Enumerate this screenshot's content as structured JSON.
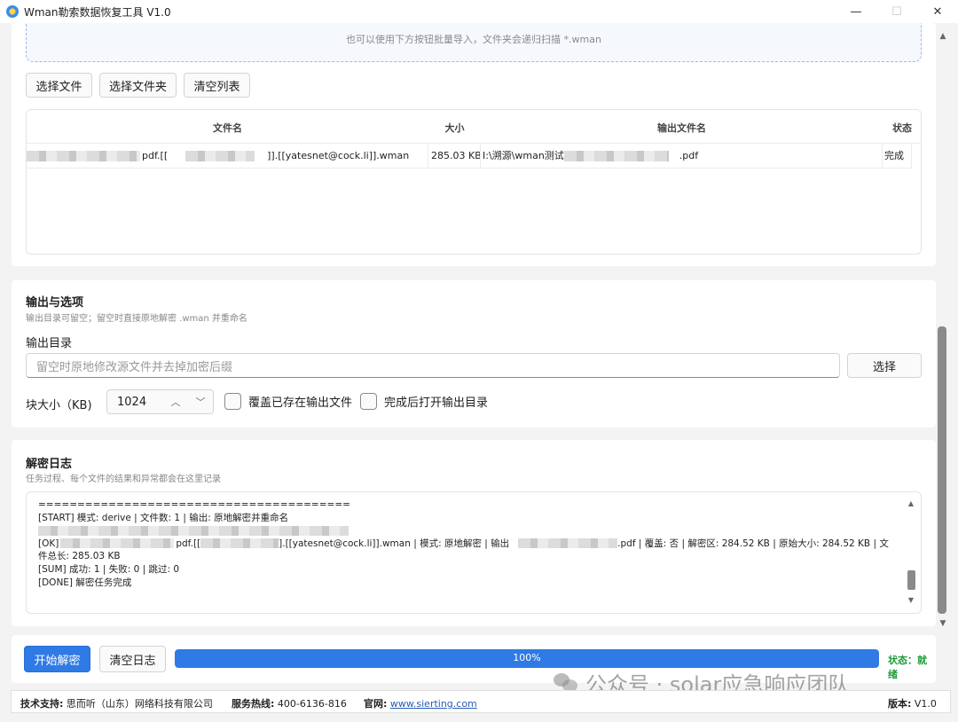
{
  "window": {
    "title": "Wman勒索数据恢复工具 V1.0",
    "minimize": "—",
    "maximize": "☐",
    "close": "✕"
  },
  "import": {
    "hint": "也可以使用下方按钮批量导入，文件夹会递归扫描 *.wman",
    "select_file": "选择文件",
    "select_folder": "选择文件夹",
    "clear_list": "清空列表"
  },
  "file_table": {
    "columns": [
      "文件名",
      "大小",
      "输出文件名",
      "状态"
    ],
    "rows": [
      {
        "name_prefix": "pdf.[[",
        "name_suffix": "]].[[yatesnet@cock.li]].wman",
        "size": "285.03 KB",
        "output_prefix": "I:\\溯源\\wman测试",
        "output_suffix": ".pdf",
        "status": "完成"
      }
    ]
  },
  "output": {
    "title": "输出与选项",
    "subtitle": "输出目录可留空；留空时直接原地解密 .wman 并重命名",
    "dir_label": "输出目录",
    "dir_placeholder": "留空时原地修改源文件并去掉加密后缀",
    "choose_btn": "选择",
    "block_label": "块大小（KB)",
    "block_value": "1024",
    "overwrite_label": "覆盖已存在输出文件",
    "open_after_label": "完成后打开输出目录"
  },
  "log": {
    "title": "解密日志",
    "subtitle": "任务过程、每个文件的结果和异常都会在这里记录",
    "separator": "========================================",
    "start": "[START] 模式: derive | 文件数: 1 | 输出: 原地解密并重命名",
    "ok_a": "[OK]",
    "ok_b": "pdf.[[",
    "ok_c": "].[[yatesnet@cock.li]].wman | 模式: 原地解密 | 输出",
    "ok_d": ".pdf | 覆盖: 否 | 解密区: 284.52 KB | 原始大小: 284.52 KB | 文",
    "ok_wrap": "件总长: 285.03 KB",
    "sum": "[SUM] 成功: 1 | 失败: 0 | 跳过: 0",
    "done": "[DONE] 解密任务完成"
  },
  "actions": {
    "start": "开始解密",
    "clear_log": "清空日志",
    "progress_text": "100%",
    "progress_value": 1.0,
    "status": "状态：就绪"
  },
  "watermark": "公众号 · solar应急响应团队",
  "footer": {
    "support_label": "技术支持:",
    "support_value": "思而听（山东）网络科技有限公司",
    "hotline_label": "服务热线:",
    "hotline_value": "400-6136-816",
    "site_label": "官网:",
    "site_value": "www.sierting.com",
    "version_label": "版本:",
    "version_value": "V1.0"
  },
  "colors": {
    "accent": "#2f7ae5",
    "status_ok": "#1e9b3c"
  }
}
